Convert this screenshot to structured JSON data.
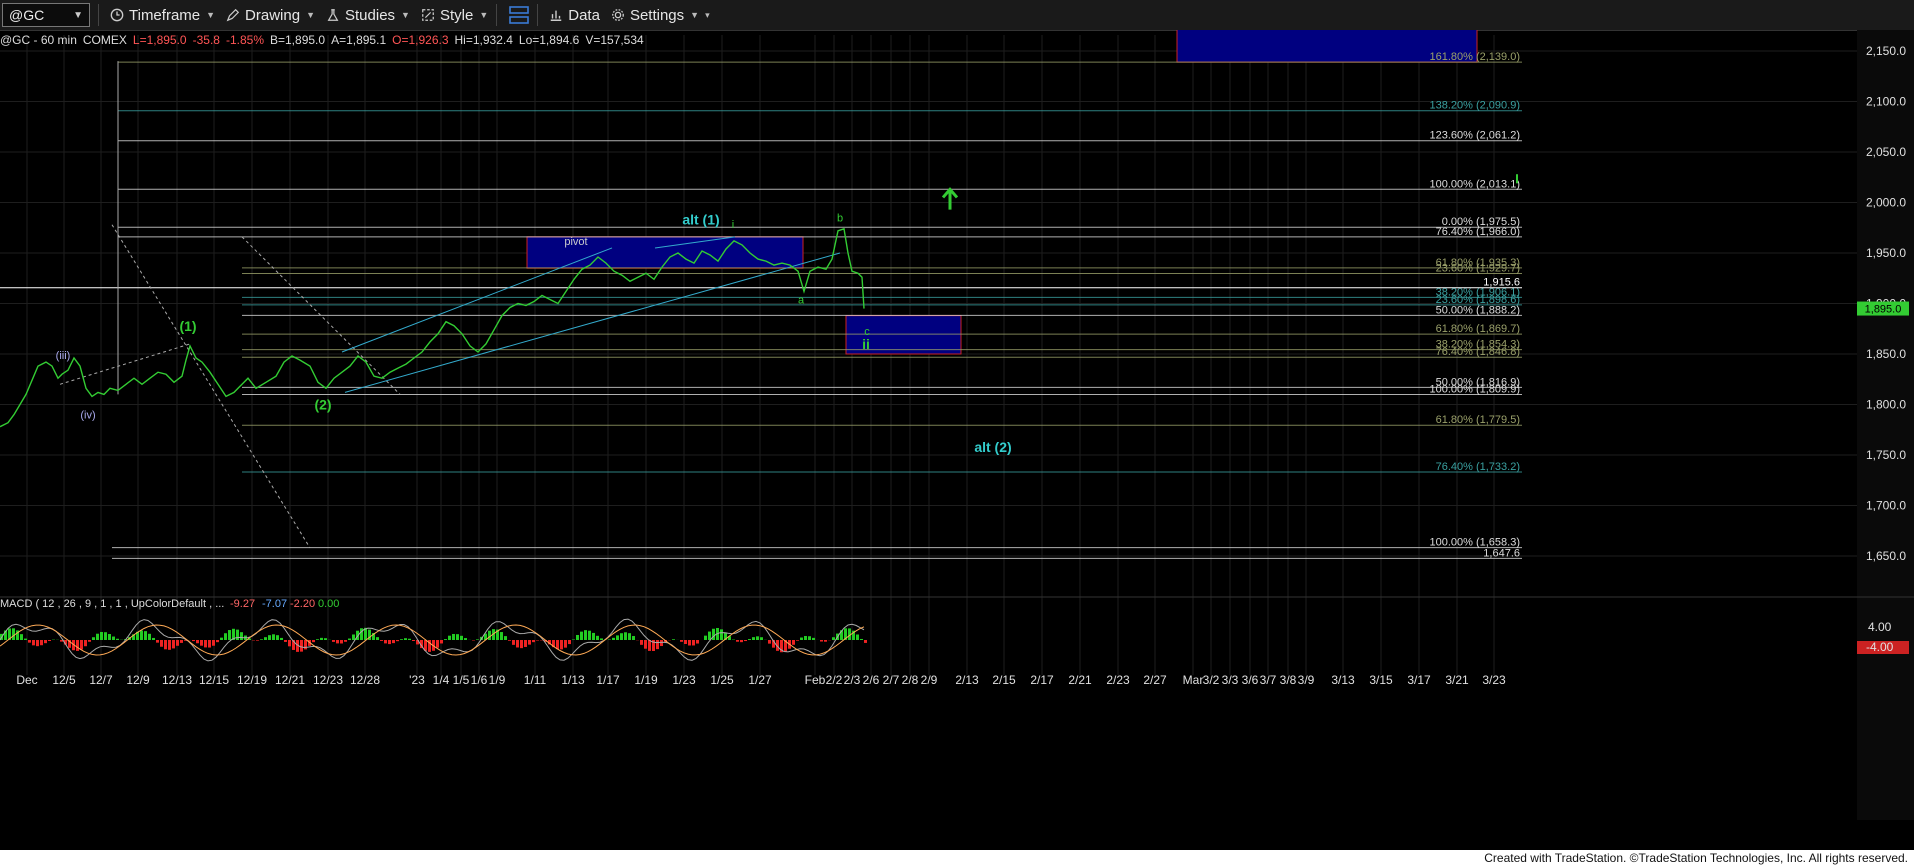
{
  "toolbar": {
    "symbol": "@GC",
    "timeframe_label": "Timeframe",
    "drawing_label": "Drawing",
    "studies_label": "Studies",
    "style_label": "Style",
    "data_label": "Data",
    "settings_label": "Settings"
  },
  "info": {
    "title": "@GC - 60 min",
    "exchange": "COMEX",
    "last": "L=1,895.0",
    "change": "-35.8",
    "change_pct": "-1.85%",
    "bid": "B=1,895.0",
    "ask": "A=1,895.1",
    "open": "O=1,926.3",
    "high": "Hi=1,932.4",
    "low": "Lo=1,894.6",
    "volume": "V=157,534"
  },
  "colors": {
    "price": "#33cc33",
    "down": "#ff3333",
    "box_fill": "#000080",
    "box_border": "#cc2222",
    "cyan_label": "#33cccc",
    "fib_green": "#88aa88",
    "grid": "#1e1e1e"
  },
  "chart_data": [
    {
      "type": "line",
      "ylim": [
        1620,
        2180
      ],
      "y_ticks": [
        "2,150.0",
        "2,100.0",
        "2,050.0",
        "2,000.0",
        "1,950.0",
        "1,900.0",
        "1,850.0",
        "1,800.0",
        "1,750.0",
        "1,700.0",
        "1,650.0"
      ],
      "x_ticks": [
        "Dec",
        "12/5",
        "12/7",
        "12/9",
        "12/13",
        "12/15",
        "12/19",
        "12/21",
        "12/23",
        "12/28",
        "'23",
        "1/4",
        "1/5",
        "1/6",
        "1/9",
        "1/11",
        "1/13",
        "1/17",
        "1/19",
        "1/23",
        "1/25",
        "1/27",
        "Feb",
        "2/2",
        "2/3",
        "2/6",
        "2/7",
        "2/8",
        "2/9",
        "2/13",
        "2/15",
        "2/17",
        "2/21",
        "2/23",
        "2/27",
        "Mar",
        "3/2",
        "3/3",
        "3/6",
        "3/7",
        "3/8",
        "3/9",
        "3/13",
        "3/15",
        "3/17",
        "3/21",
        "3/23"
      ],
      "last_price_label": "1,895.0",
      "price_marker_label": "1,915.6",
      "price_marker_value": 1915.6,
      "price_series": [
        [
          0,
          1778
        ],
        [
          8,
          1782
        ],
        [
          14,
          1790
        ],
        [
          20,
          1800
        ],
        [
          26,
          1810
        ],
        [
          32,
          1824
        ],
        [
          38,
          1838
        ],
        [
          46,
          1842
        ],
        [
          52,
          1838
        ],
        [
          58,
          1826
        ],
        [
          62,
          1830
        ],
        [
          68,
          1834
        ],
        [
          74,
          1846
        ],
        [
          80,
          1838
        ],
        [
          86,
          1816
        ],
        [
          92,
          1808
        ],
        [
          98,
          1812
        ],
        [
          104,
          1810
        ],
        [
          110,
          1816
        ],
        [
          118,
          1814
        ],
        [
          126,
          1820
        ],
        [
          134,
          1826
        ],
        [
          142,
          1820
        ],
        [
          150,
          1826
        ],
        [
          158,
          1832
        ],
        [
          166,
          1830
        ],
        [
          174,
          1822
        ],
        [
          182,
          1828
        ],
        [
          186,
          1844
        ],
        [
          190,
          1858
        ],
        [
          196,
          1846
        ],
        [
          202,
          1842
        ],
        [
          210,
          1832
        ],
        [
          218,
          1820
        ],
        [
          226,
          1808
        ],
        [
          234,
          1812
        ],
        [
          240,
          1818
        ],
        [
          248,
          1826
        ],
        [
          256,
          1816
        ],
        [
          266,
          1822
        ],
        [
          276,
          1828
        ],
        [
          284,
          1842
        ],
        [
          292,
          1848
        ],
        [
          300,
          1844
        ],
        [
          310,
          1838
        ],
        [
          318,
          1822
        ],
        [
          326,
          1816
        ],
        [
          334,
          1826
        ],
        [
          342,
          1832
        ],
        [
          350,
          1838
        ],
        [
          358,
          1848
        ],
        [
          366,
          1842
        ],
        [
          374,
          1828
        ],
        [
          382,
          1826
        ],
        [
          390,
          1832
        ],
        [
          398,
          1836
        ],
        [
          406,
          1840
        ],
        [
          414,
          1846
        ],
        [
          422,
          1852
        ],
        [
          430,
          1862
        ],
        [
          438,
          1870
        ],
        [
          446,
          1882
        ],
        [
          454,
          1878
        ],
        [
          462,
          1870
        ],
        [
          470,
          1858
        ],
        [
          478,
          1852
        ],
        [
          486,
          1860
        ],
        [
          494,
          1874
        ],
        [
          502,
          1888
        ],
        [
          510,
          1896
        ],
        [
          518,
          1900
        ],
        [
          526,
          1898
        ],
        [
          534,
          1902
        ],
        [
          542,
          1908
        ],
        [
          550,
          1904
        ],
        [
          558,
          1900
        ],
        [
          566,
          1912
        ],
        [
          574,
          1924
        ],
        [
          582,
          1934
        ],
        [
          590,
          1938
        ],
        [
          598,
          1946
        ],
        [
          606,
          1940
        ],
        [
          614,
          1932
        ],
        [
          622,
          1928
        ],
        [
          630,
          1922
        ],
        [
          638,
          1926
        ],
        [
          646,
          1930
        ],
        [
          654,
          1924
        ],
        [
          662,
          1936
        ],
        [
          670,
          1946
        ],
        [
          678,
          1950
        ],
        [
          686,
          1944
        ],
        [
          694,
          1940
        ],
        [
          702,
          1952
        ],
        [
          710,
          1948
        ],
        [
          718,
          1942
        ],
        [
          726,
          1954
        ],
        [
          734,
          1962
        ],
        [
          742,
          1958
        ],
        [
          750,
          1950
        ],
        [
          758,
          1944
        ],
        [
          766,
          1942
        ],
        [
          774,
          1938
        ],
        [
          782,
          1940
        ],
        [
          790,
          1938
        ],
        [
          798,
          1932
        ],
        [
          804,
          1912
        ],
        [
          810,
          1932
        ],
        [
          818,
          1936
        ],
        [
          826,
          1934
        ],
        [
          832,
          1944
        ],
        [
          838,
          1972
        ],
        [
          844,
          1974
        ],
        [
          848,
          1950
        ],
        [
          852,
          1932
        ],
        [
          858,
          1930
        ],
        [
          862,
          1926
        ],
        [
          864,
          1895
        ]
      ],
      "macd_label": "MACD ( 12 , 26 , 9 , 1 , 1 , UpColorDefault , ...",
      "macd_values": [
        "-9.27",
        "-7.07",
        "-2.20",
        "0.00"
      ],
      "macd_axis_labels": [
        "4.00",
        "-4.00"
      ],
      "fib_levels": [
        {
          "label": "161.80% (2,139.0)",
          "value": 2139.0
        },
        {
          "label": "138.20% (2,090.9)",
          "value": 2090.9
        },
        {
          "label": "123.60% (2,061.2)",
          "value": 2061.2
        },
        {
          "label": "100.00% (2,013.1)",
          "value": 2013.1
        },
        {
          "label": "0.00% (1,975.5)",
          "value": 1975.5
        },
        {
          "label": "76.40% (1,966.0)",
          "value": 1966.0
        },
        {
          "label": "61.80% (1,935.3)",
          "value": 1935.3
        },
        {
          "label": "23.60% (1,929.7)",
          "value": 1929.7
        },
        {
          "label": "38.20% (1,906.1)",
          "value": 1906.1
        },
        {
          "label": "23.60% (1,898.6)",
          "value": 1898.6
        },
        {
          "label": "50.00% (1,888.2)",
          "value": 1888.2
        },
        {
          "label": "61.80% (1,869.7)",
          "value": 1869.7
        },
        {
          "label": "38.20% (1,854.3)",
          "value": 1854.3
        },
        {
          "label": "76.40% (1,846.8)",
          "value": 1846.8
        },
        {
          "label": "50.00% (1,816.9)",
          "value": 1816.9
        },
        {
          "label": "100.00% (1,809.9)",
          "value": 1809.9
        },
        {
          "label": "61.80% (1,779.5)",
          "value": 1779.5
        },
        {
          "label": "76.40% (1,733.2)",
          "value": 1733.2
        },
        {
          "label": "100.00% (1,658.3)",
          "value": 1658.3
        },
        {
          "label": "1,647.6",
          "value": 1647.6
        }
      ],
      "annotations": [
        {
          "text": "(iii)",
          "color": "#aaaaee"
        },
        {
          "text": "(iv)",
          "color": "#aaaaee"
        },
        {
          "text": "(1)",
          "color": "#33cc33"
        },
        {
          "text": "(2)",
          "color": "#33cc33"
        },
        {
          "text": "pivot",
          "color": "#cccccc"
        },
        {
          "text": "alt (1)",
          "color": "#33cccc"
        },
        {
          "text": "i",
          "color": "#33cc33"
        },
        {
          "text": "a",
          "color": "#33cc33"
        },
        {
          "text": "b",
          "color": "#33cc33"
        },
        {
          "text": "c",
          "color": "#33cc33"
        },
        {
          "text": "ii",
          "color": "#33cc33"
        },
        {
          "text": "alt (2)",
          "color": "#33cccc"
        }
      ]
    }
  ],
  "footer": {
    "credit": "Created with TradeStation. ©TradeStation Technologies, Inc. All rights reserved."
  }
}
